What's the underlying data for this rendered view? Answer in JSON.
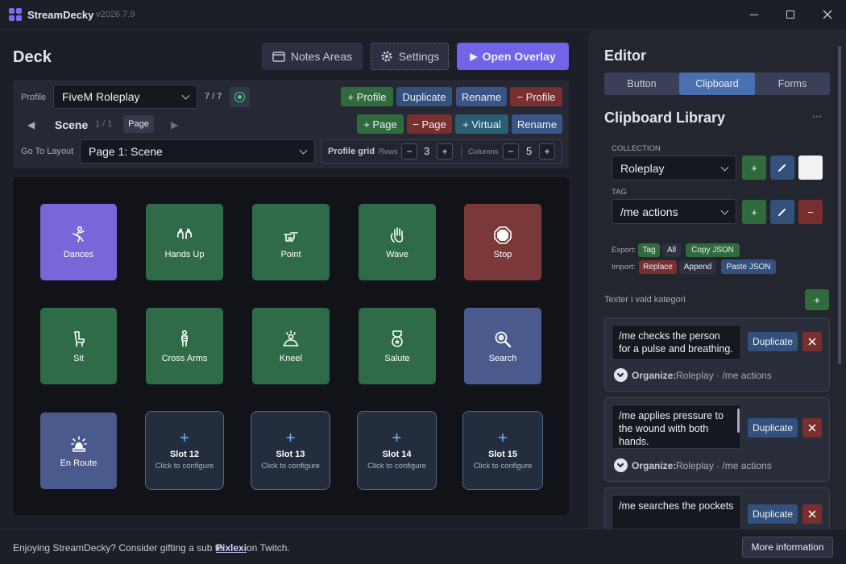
{
  "app": {
    "name": "StreamDecky",
    "version": "v2026.7.9"
  },
  "deck": {
    "title": "Deck",
    "notes_label": "Notes Areas",
    "settings_label": "Settings",
    "overlay_label": "Open Overlay",
    "profile_label": "Profile",
    "profile_value": "FiveM Roleplay",
    "profile_count": "7 / 7",
    "add_profile": "+ Profile",
    "duplicate": "Duplicate",
    "rename": "Rename",
    "remove_profile": "− Profile",
    "scene_label": "Scene",
    "scene_count": "1 / 1",
    "page_badge": "Page",
    "add_page": "+ Page",
    "remove_page": "− Page",
    "add_virtual": "+ Virtual",
    "rename2": "Rename",
    "goto_label": "Go To Layout",
    "goto_value": "Page 1: Scene",
    "grid_label": "Profile grid",
    "rows_label": "Rows",
    "rows_value": "3",
    "cols_label": "Columns",
    "cols_value": "5"
  },
  "tiles": [
    {
      "label": "Dances",
      "icon": "dance-icon",
      "color": "#7767d8"
    },
    {
      "label": "Hands Up",
      "icon": "hands-up-icon",
      "color": "#2f6b48"
    },
    {
      "label": "Point",
      "icon": "point-icon",
      "color": "#2f6b48"
    },
    {
      "label": "Wave",
      "icon": "wave-icon",
      "color": "#2f6b48"
    },
    {
      "label": "Stop",
      "icon": "stop-icon",
      "color": "#7a3838"
    },
    {
      "label": "Sit",
      "icon": "chair-icon",
      "color": "#2f6b48"
    },
    {
      "label": "Cross Arms",
      "icon": "person-icon",
      "color": "#2f6b48"
    },
    {
      "label": "Kneel",
      "icon": "kneel-icon",
      "color": "#2f6b48"
    },
    {
      "label": "Salute",
      "icon": "medal-icon",
      "color": "#2f6b48"
    },
    {
      "label": "Search",
      "icon": "magnifier-icon",
      "color": "#4a5a8c"
    },
    {
      "label": "En Route",
      "icon": "siren-icon",
      "color": "#4a5a8c"
    }
  ],
  "slots": [
    {
      "title": "Slot 12",
      "sub": "Click to configure"
    },
    {
      "title": "Slot 13",
      "sub": "Click to configure"
    },
    {
      "title": "Slot 14",
      "sub": "Click to configure"
    },
    {
      "title": "Slot 15",
      "sub": "Click to configure"
    }
  ],
  "editor": {
    "title": "Editor",
    "tabs": [
      "Button",
      "Clipboard",
      "Forms"
    ],
    "active_tab": "Clipboard",
    "library_title": "Clipboard Library",
    "more": "···",
    "collection_label": "COLLECTION",
    "collection_value": "Roleplay",
    "tag_label": "TAG",
    "tag_value": "/me actions",
    "export_label": "Export:",
    "export_tag": "Tag",
    "export_all": "All",
    "copy_json": "Copy JSON",
    "import_label": "Import:",
    "replace": "Replace",
    "append": "Append",
    "paste_json": "Paste JSON",
    "category_label": "Texter i vald kategori",
    "organize_label": "Organize:",
    "cards": [
      {
        "text": "/me checks the person for a pulse and breathing.",
        "path": "Roleplay · /me actions"
      },
      {
        "text": "/me applies pressure to the wound with both hands.",
        "path": "Roleplay · /me actions"
      },
      {
        "text": "/me searches the pockets",
        "path": ""
      }
    ],
    "dup_label": "Duplicate"
  },
  "footer": {
    "text1": "Enjoying StreamDecky? Consider gifting a sub to",
    "link": "Pixlexi",
    "text2": "on Twitch.",
    "more_info": "More information"
  },
  "colors": {
    "accent": "#7064e8",
    "green": "#2f6b3c",
    "red": "#7a2f2f",
    "blue": "#34507c"
  }
}
